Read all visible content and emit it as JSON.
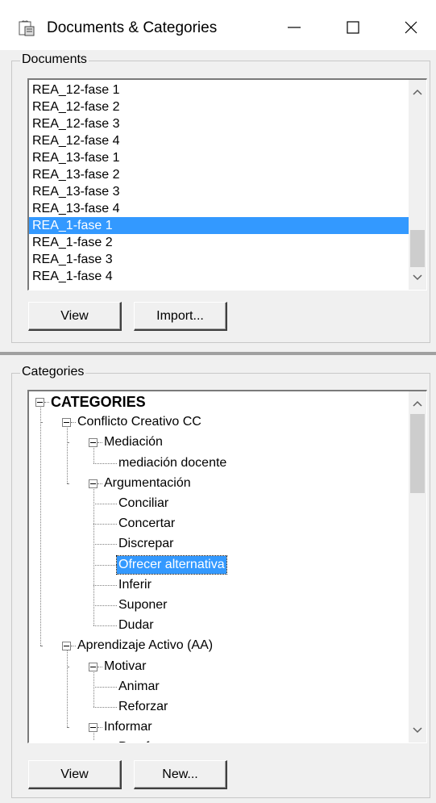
{
  "window": {
    "title": "Documents & Categories",
    "icon": "app-icon"
  },
  "documents": {
    "group_label": "Documents",
    "items": [
      "REA_12-fase 1",
      "REA_12-fase 2",
      "REA_12-fase 3",
      "REA_12-fase 4",
      "REA_13-fase 1",
      "REA_13-fase 2",
      "REA_13-fase 3",
      "REA_13-fase 4",
      "REA_1-fase 1",
      "REA_1-fase 2",
      "REA_1-fase 3",
      "REA_1-fase 4"
    ],
    "selected_index": 8,
    "view_button": "View",
    "import_button": "Import..."
  },
  "categories": {
    "group_label": "Categories",
    "tree": [
      {
        "label": "CATEGORIES",
        "level": 0,
        "expandable": true
      },
      {
        "label": "Conflicto Creativo CC",
        "level": 1,
        "expandable": true
      },
      {
        "label": "Mediación",
        "level": 2,
        "expandable": true
      },
      {
        "label": "mediación docente",
        "level": 3
      },
      {
        "label": "Argumentación",
        "level": 2,
        "expandable": true
      },
      {
        "label": "Conciliar",
        "level": 3
      },
      {
        "label": "Concertar",
        "level": 3
      },
      {
        "label": "Discrepar",
        "level": 3
      },
      {
        "label": "Ofrecer alternativa",
        "level": 3,
        "selected": true
      },
      {
        "label": "Inferir",
        "level": 3
      },
      {
        "label": "Suponer",
        "level": 3
      },
      {
        "label": "Dudar",
        "level": 3
      },
      {
        "label": "Aprendizaje Activo (AA)",
        "level": 1,
        "expandable": true
      },
      {
        "label": "Motivar",
        "level": 2,
        "expandable": true
      },
      {
        "label": "Animar",
        "level": 3
      },
      {
        "label": "Reforzar",
        "level": 3
      },
      {
        "label": "Informar",
        "level": 2,
        "expandable": true
      },
      {
        "label": "Proof...",
        "level": 3
      }
    ],
    "view_button": "View",
    "new_button": "New..."
  }
}
